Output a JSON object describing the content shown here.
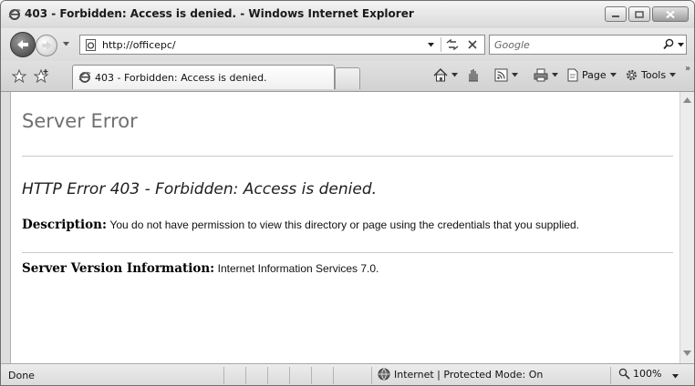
{
  "window": {
    "title": "403 - Forbidden: Access is denied. - Windows Internet Explorer"
  },
  "address": {
    "url": "http://officepc/"
  },
  "search": {
    "placeholder": "Google"
  },
  "tab": {
    "label": "403 - Forbidden: Access is denied."
  },
  "commands": {
    "page_label": "Page",
    "tools_label": "Tools",
    "more": "»"
  },
  "content": {
    "heading": "Server Error",
    "error_title": "HTTP Error 403 - Forbidden: Access is denied.",
    "description_label": "Description:",
    "description_text": "You do not have permission to view this directory or page using the credentials that you supplied.",
    "version_label": "Server Version Information:",
    "version_text": "Internet Information Services 7.0."
  },
  "status": {
    "text": "Done",
    "zone": "Internet | Protected Mode: On",
    "zoom": "100%"
  },
  "icons": {
    "title": "ie-logo-icon",
    "back": "back-arrow-icon",
    "forward": "forward-arrow-icon",
    "refresh": "refresh-icon",
    "stop": "stop-icon",
    "search": "search-icon",
    "favorites": "favorites-star-icon",
    "add_favorites": "add-favorites-icon",
    "home": "home-icon",
    "research": "research-hand-icon",
    "feeds": "feeds-icon",
    "print": "print-icon",
    "page": "page-icon",
    "tools": "gear-icon",
    "zone": "globe-icon",
    "zoom": "magnifier-icon"
  }
}
